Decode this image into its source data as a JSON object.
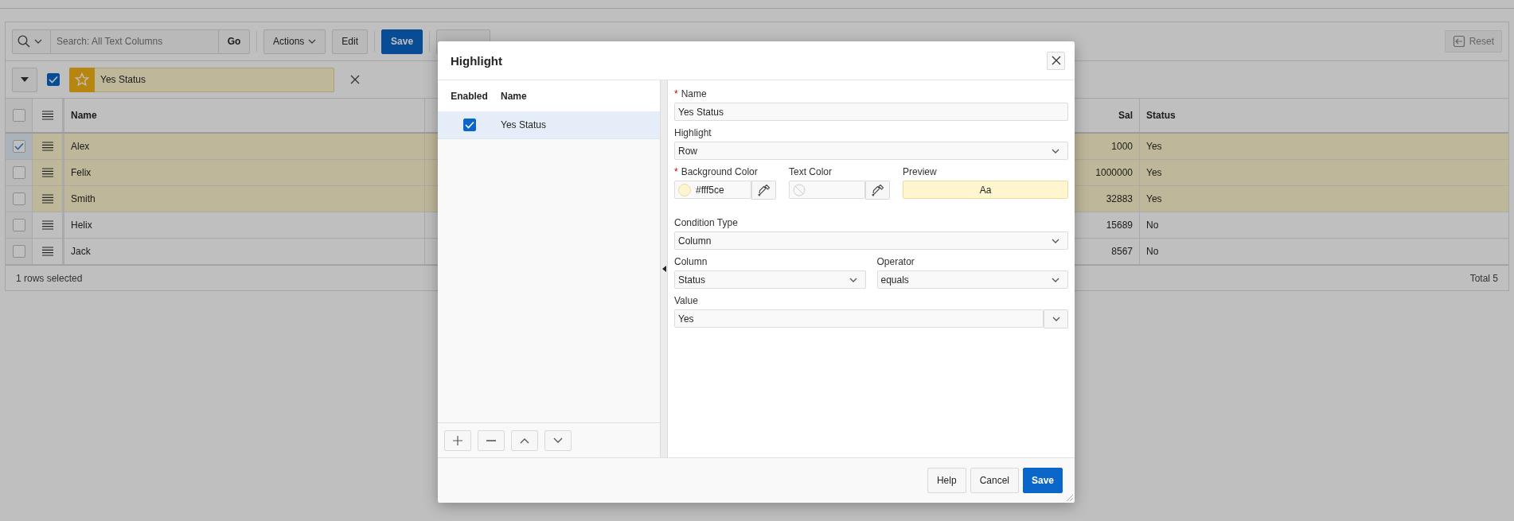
{
  "toolbar": {
    "search": {
      "placeholder": "Search: All Text Columns"
    },
    "buttons": [
      {
        "label": "Go",
        "kind": "go"
      },
      {
        "label": "Actions",
        "kind": "menu"
      },
      {
        "label": "Edit",
        "kind": "plain"
      },
      {
        "label": "Save",
        "kind": "primary"
      },
      {
        "kind": "plain"
      }
    ],
    "reset": {
      "label": "Reset",
      "disabled": true
    }
  },
  "filter": {
    "enabled": true,
    "label": "Yes Status"
  },
  "grid": {
    "all_selected": false,
    "columns": [
      {
        "label": "Name",
        "numeric": false
      },
      {
        "label": "Sal",
        "numeric": true
      },
      {
        "label": "Status",
        "numeric": false
      }
    ],
    "rows": [
      {
        "selected": true,
        "highlighted": true,
        "cells": [
          "Alex",
          "1000",
          "Yes"
        ]
      },
      {
        "selected": false,
        "highlighted": true,
        "cells": [
          "Felix",
          "1000000",
          "Yes"
        ]
      },
      {
        "selected": false,
        "highlighted": true,
        "cells": [
          "Smith",
          "32883",
          "Yes"
        ]
      },
      {
        "selected": false,
        "highlighted": false,
        "cells": [
          "Helix",
          "15689",
          "No"
        ]
      },
      {
        "selected": false,
        "highlighted": false,
        "cells": [
          "Jack",
          "8567",
          "No"
        ]
      }
    ],
    "selection": "1 rows selected",
    "total": "Total 5"
  },
  "dialog": {
    "title": "Highlight",
    "list": {
      "columns": [
        "Enabled",
        "Name"
      ],
      "items": [
        {
          "enabled": true,
          "selected": true,
          "name": "Yes Status"
        }
      ]
    },
    "form": {
      "required_mark": "*",
      "name": {
        "label": "Name",
        "required": true,
        "value": "Yes Status"
      },
      "highlight": {
        "label": "Highlight",
        "value": "Row"
      },
      "background_color": {
        "label": "Background Color",
        "required": true,
        "value": "#fff5ce",
        "color": "#fff5ce"
      },
      "text_color": {
        "label": "Text Color",
        "required": false
      },
      "preview": {
        "label": "Preview",
        "text": "Aa"
      },
      "condition_type": {
        "label": "Condition Type",
        "value": "Column"
      },
      "column": {
        "label": "Column",
        "value": "Status"
      },
      "operator": {
        "label": "Operator",
        "value": "equals"
      },
      "value": {
        "label": "Value",
        "value": "Yes"
      }
    },
    "buttons": [
      {
        "label": "Help",
        "kind": "plain"
      },
      {
        "label": "Cancel",
        "kind": "plain"
      },
      {
        "label": "Save",
        "kind": "primary"
      }
    ]
  }
}
